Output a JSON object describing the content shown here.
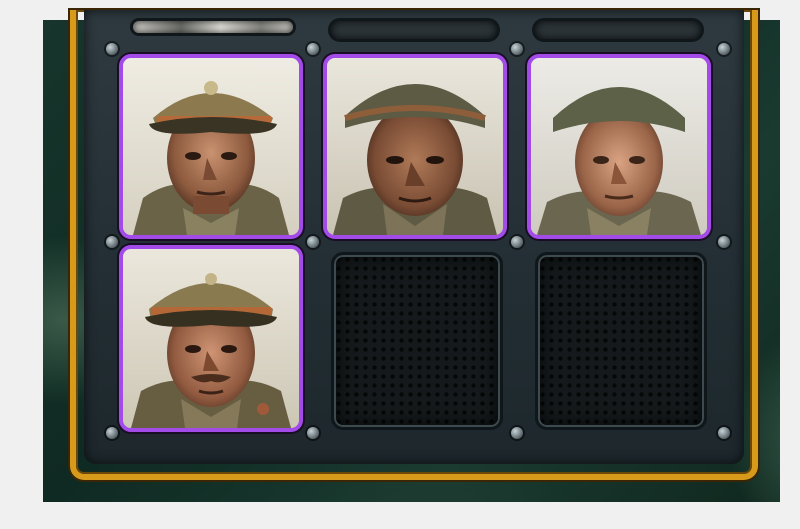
{
  "panel": {
    "slots": [
      {
        "id": "top-left",
        "state": "partial-portrait"
      },
      {
        "id": "top-middle",
        "state": "partial-empty"
      },
      {
        "id": "top-right",
        "state": "partial-empty"
      },
      {
        "id": "r1c1",
        "state": "filled",
        "portrait": "officer-peaked-cap"
      },
      {
        "id": "r1c2",
        "state": "filled",
        "portrait": "soldier-helmet-older"
      },
      {
        "id": "r1c3",
        "state": "filled",
        "portrait": "soldier-helmet-younger"
      },
      {
        "id": "r2c1",
        "state": "filled",
        "portrait": "officer-peaked-cap-mustache"
      },
      {
        "id": "r2c2",
        "state": "empty"
      },
      {
        "id": "r2c3",
        "state": "empty"
      }
    ],
    "colors": {
      "rarity_border": "#a24be8",
      "frame_gold": "#d89a1a",
      "backdrop_green": "#17352c",
      "steel": "#2e3a40"
    }
  }
}
